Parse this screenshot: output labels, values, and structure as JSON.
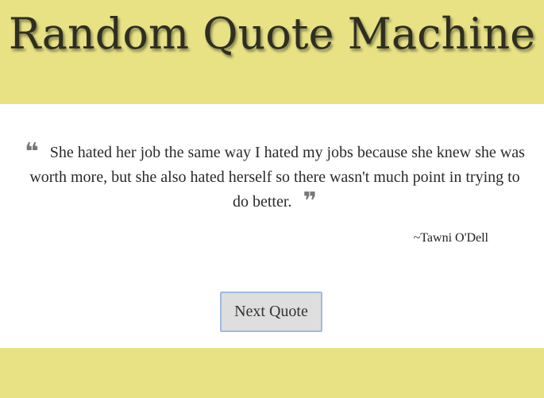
{
  "header": {
    "title": "Random Quote Machine"
  },
  "quote": {
    "text": "She hated her job the same way I hated my jobs because she knew she was worth more, but she also hated herself so there wasn't much point in trying to do better.",
    "author": "~Tawni O'Dell",
    "open_mark": "❝",
    "close_mark": "❞"
  },
  "actions": {
    "next_label": "Next Quote"
  },
  "colors": {
    "band": "#e8e285",
    "title_text": "#2e2e22",
    "quote_mark": "#777777",
    "button_bg": "#dedede",
    "button_border": "#9fbbe0"
  }
}
